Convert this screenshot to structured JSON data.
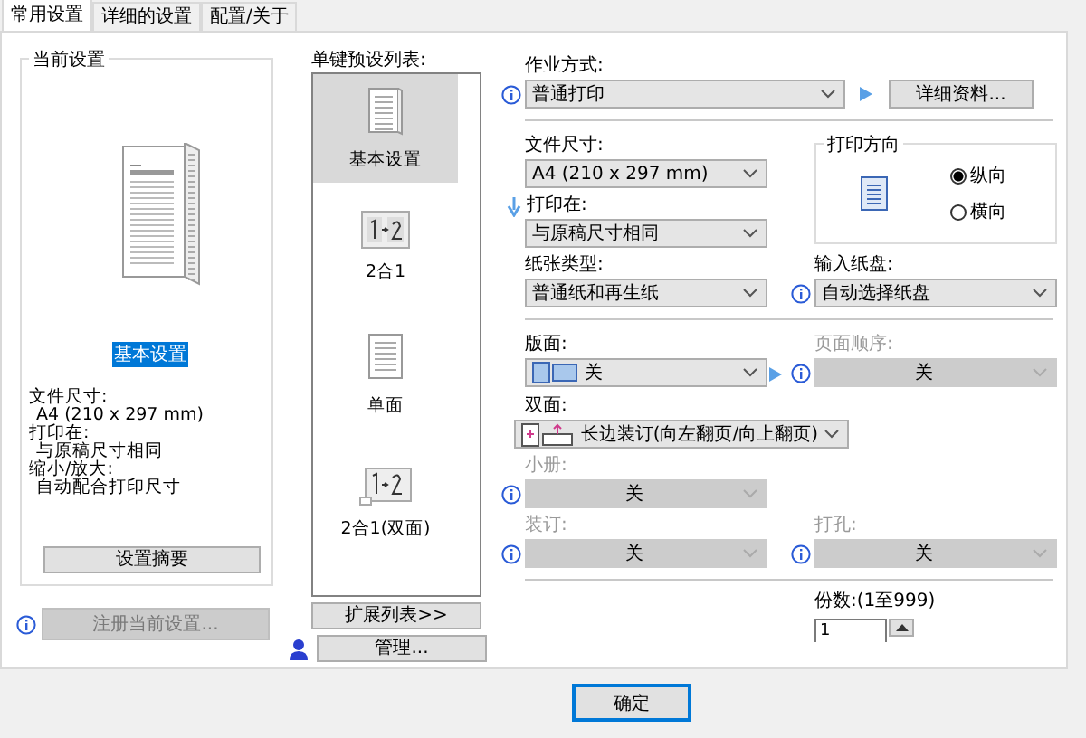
{
  "tabs": [
    {
      "label": "常用设置",
      "selected": true
    },
    {
      "label": "详细的设置",
      "selected": false
    },
    {
      "label": "配置/关于",
      "selected": false
    }
  ],
  "current_settings": {
    "title": "当前设置",
    "preset_name": "基本设置",
    "lines": [
      {
        "label": "文件尺寸:",
        "value": "A4 (210 x 297 mm)"
      },
      {
        "label": "打印在:",
        "value": "与原稿尺寸相同"
      },
      {
        "label": "缩小/放大:",
        "value": "自动配合打印尺寸"
      }
    ],
    "summary_button": "设置摘要"
  },
  "register_button": {
    "label": "注册当前设置...",
    "disabled": true
  },
  "presets": {
    "label": "单键预设列表:",
    "items": [
      {
        "label": "基本设置",
        "kind": "document",
        "selected": true
      },
      {
        "label": "2合1",
        "kind": "two_in_one",
        "selected": false
      },
      {
        "label": "单面",
        "kind": "single",
        "selected": false
      },
      {
        "label": "2合1(双面)",
        "kind": "two_in_one_duplex",
        "selected": false
      }
    ]
  },
  "expand_button": "扩展列表>>",
  "manage_button": "管理...",
  "job_mode": {
    "label": "作业方式:",
    "value": "普通打印",
    "disabled": false,
    "details_button": "详细资料..."
  },
  "paper_size": {
    "label": "文件尺寸:",
    "value": "A4 (210 x 297 mm)",
    "disabled": false
  },
  "print_on": {
    "label": "打印在:",
    "value": "与原稿尺寸相同",
    "disabled": false
  },
  "orientation": {
    "title": "打印方向",
    "options": [
      {
        "label": "纵向",
        "selected": true
      },
      {
        "label": "横向",
        "selected": false
      }
    ]
  },
  "paper_type": {
    "label": "纸张类型:",
    "value": "普通纸和再生纸",
    "disabled": false
  },
  "input_tray": {
    "label": "输入纸盘:",
    "value": "自动选择纸盘",
    "disabled": false
  },
  "layout": {
    "label": "版面:",
    "value": "关",
    "disabled": false
  },
  "page_order": {
    "label": "页面顺序:",
    "value": "关",
    "disabled": true
  },
  "duplex": {
    "label": "双面:",
    "value": "长边装订(向左翻页/向上翻页)",
    "disabled": false
  },
  "booklet": {
    "label": "小册:",
    "value": "关",
    "disabled": true
  },
  "staple": {
    "label": "装订:",
    "value": "关",
    "disabled": true
  },
  "punch": {
    "label": "打孔:",
    "value": "关",
    "disabled": true
  },
  "copies": {
    "label": "份数:(1至999)",
    "value": "1"
  },
  "ok_button": "确定"
}
